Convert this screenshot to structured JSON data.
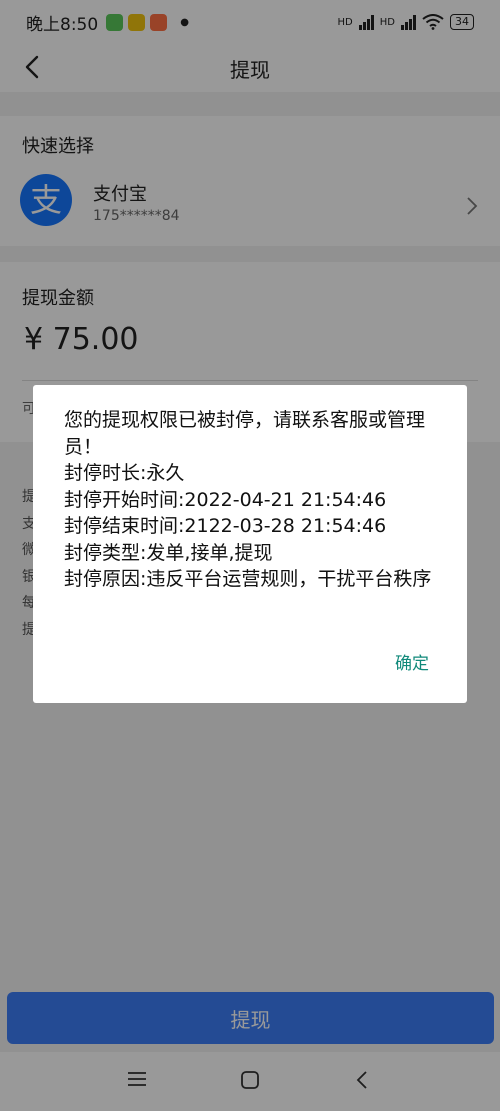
{
  "status_bar": {
    "time": "晚上8:50",
    "battery": "34",
    "hd1": "HD",
    "hd2": "HD"
  },
  "nav": {
    "title": "提现"
  },
  "quick_select": {
    "title": "快速选择",
    "method_name": "支付宝",
    "method_icon_char": "支",
    "account_masked": "175******84"
  },
  "amount": {
    "title": "提现金额",
    "value": "¥ 75.00",
    "hint_partial": "可"
  },
  "rules_partial": [
    "提",
    "支",
    "微",
    "银",
    "每",
    "提"
  ],
  "withdraw_button": "提现",
  "dialog": {
    "lines": [
      "您的提现权限已被封停，请联系客服或管理员！",
      "封停时长:永久",
      "封停开始时间:2022-04-21 21:54:46",
      "封停结束时间:2122-03-28 21:54:46",
      "封停类型:发单,接单,提现",
      "封停原因:违反平台运营规则，干扰平台秩序"
    ],
    "ok_label": "确定"
  },
  "colors": {
    "primary": "#3d7ef7",
    "alipay": "#1677ff",
    "dialog_ok": "#10897a"
  }
}
